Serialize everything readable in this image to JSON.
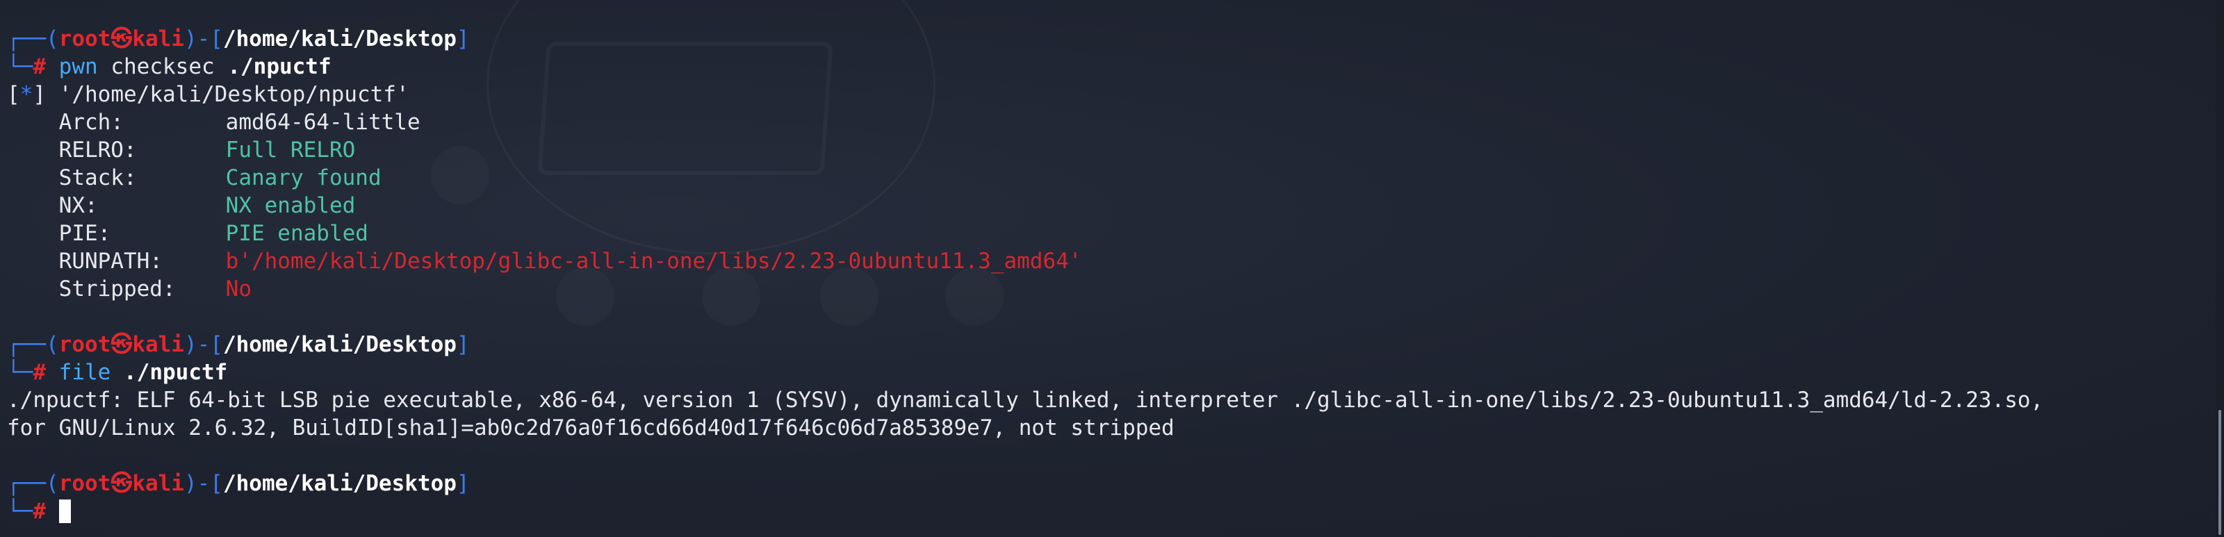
{
  "prompt": {
    "open_bracket": "┌──(",
    "user": "root",
    "at_symbol": "㉿",
    "host": "kali",
    "mid": ")-[",
    "close_bracket": "]",
    "prompt_line_start": "└─",
    "prompt_char": "#"
  },
  "block1": {
    "cwd": "/home/kali/Desktop",
    "command": "pwn",
    "args": "checksec",
    "target": "./npuctf",
    "info_marker": "[*]",
    "info_path": "'/home/kali/Desktop/npuctf'",
    "fields": [
      {
        "key": "Arch:",
        "value": "amd64-64-little",
        "style": "plain"
      },
      {
        "key": "RELRO:",
        "value": "Full RELRO",
        "style": "green"
      },
      {
        "key": "Stack:",
        "value": "Canary found",
        "style": "green"
      },
      {
        "key": "NX:",
        "value": "NX enabled",
        "style": "green"
      },
      {
        "key": "PIE:",
        "value": "PIE enabled",
        "style": "green"
      },
      {
        "key": "RUNPATH:",
        "value": "b'/home/kali/Desktop/glibc-all-in-one/libs/2.23-0ubuntu11.3_amd64'",
        "style": "err"
      },
      {
        "key": "Stripped:",
        "value": "No",
        "style": "err"
      }
    ]
  },
  "block2": {
    "cwd": "/home/kali/Desktop",
    "command": "file",
    "target": "./npuctf",
    "output_line1": "./npuctf: ELF 64-bit LSB pie executable, x86-64, version 1 (SYSV), dynamically linked, interpreter ./glibc-all-in-one/libs/2.23-0ubuntu11.3_amd64/ld-2.23.so,",
    "output_line2": "for GNU/Linux 2.6.32, BuildID[sha1]=ab0c2d76a0f16cd66d40d17f646c06d7a85389e7, not stripped"
  },
  "block3": {
    "cwd": "/home/kali/Desktop"
  },
  "colors": {
    "background": "#1f2432",
    "prompt_frame": "#3d7cf0",
    "prompt_user": "#e2282f",
    "command": "#45a9f7",
    "ok_value": "#4fc3a5",
    "bad_value": "#d9262e"
  }
}
